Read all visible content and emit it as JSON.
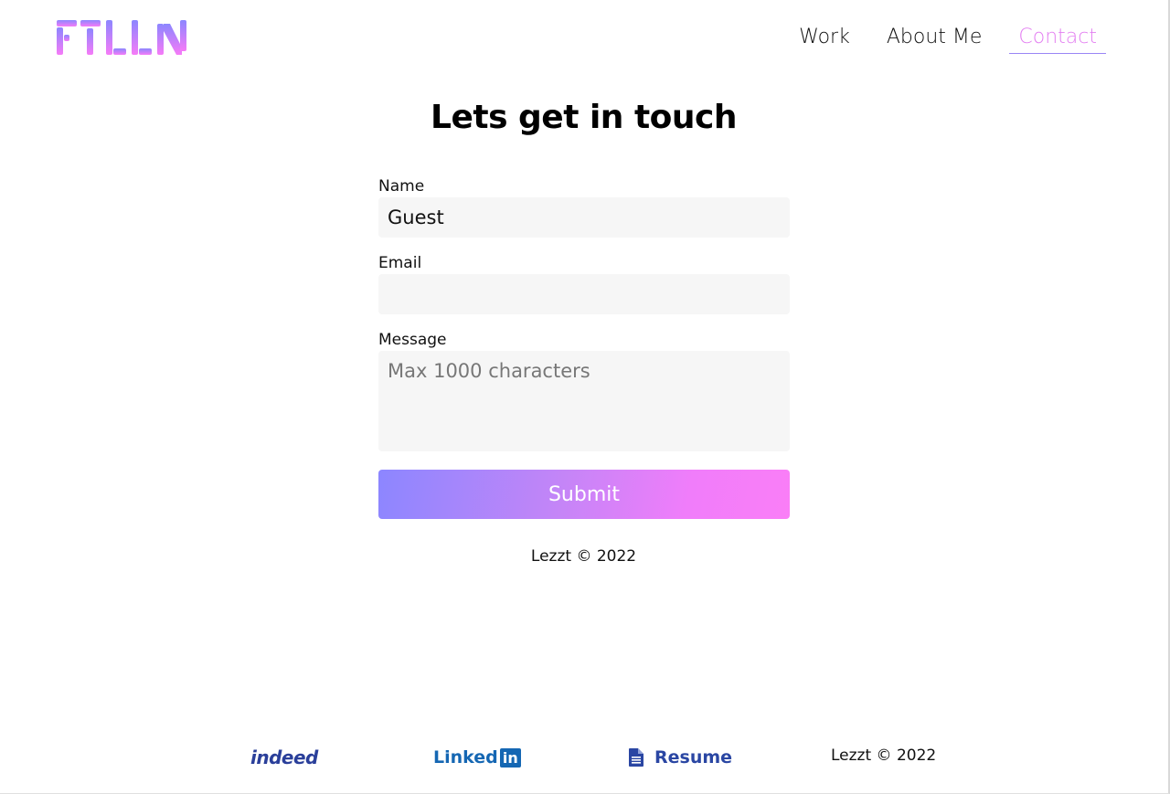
{
  "header": {
    "logo_text": "FTLLN",
    "nav": [
      {
        "label": "Work"
      },
      {
        "label": "About Me"
      },
      {
        "label": "Contact"
      }
    ]
  },
  "main": {
    "title": "Lets get in touch",
    "form": {
      "name_label": "Name",
      "name_value": "Guest",
      "email_label": "Email",
      "email_value": "",
      "message_label": "Message",
      "message_placeholder": "Max 1000 characters",
      "submit_label": "Submit"
    },
    "copyright": "Lezzt © 2022"
  },
  "footer": {
    "indeed_label": "indeed",
    "linkedin_label": "Linked",
    "linkedin_box": "in",
    "resume_label": "Resume",
    "copyright": "Lezzt © 2022"
  },
  "colors": {
    "accent_pink": "#e37ff1",
    "gradient_start": "#8c86ff",
    "gradient_end": "#fa7ef7",
    "indeed_blue": "#2a3f9a",
    "linkedin_blue": "#1567b3"
  }
}
